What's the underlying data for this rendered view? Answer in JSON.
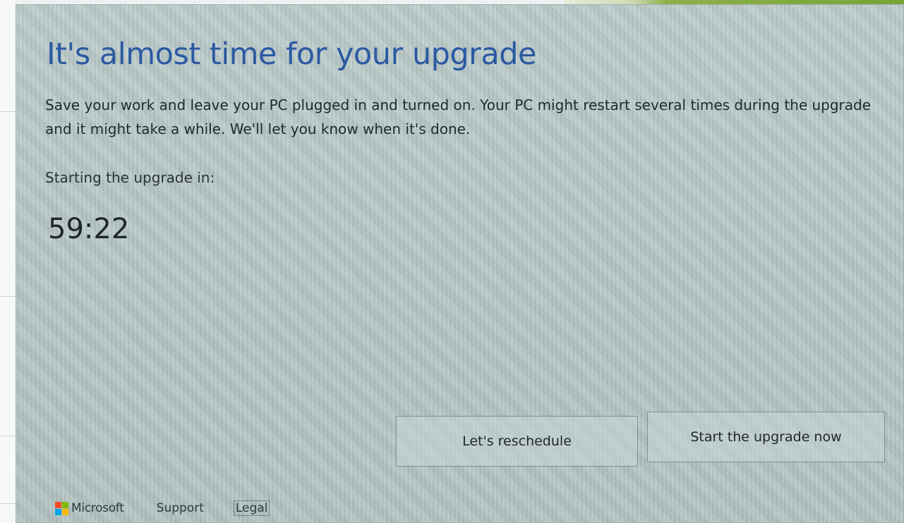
{
  "dialog": {
    "title": "It's almost time for your upgrade",
    "description": "Save your work and leave your PC plugged in and turned on. Your PC might restart several times during the upgrade and it might take a while. We'll let you know when it's done.",
    "countdown_label": "Starting the upgrade in:",
    "countdown_value": "59:22"
  },
  "buttons": {
    "reschedule_label": "Let's reschedule",
    "start_now_label": "Start the upgrade now"
  },
  "footer": {
    "brand": "Microsoft",
    "support": "Support",
    "legal": "Legal"
  },
  "colors": {
    "title": "#2b5aa3",
    "logo_red": "#f25022",
    "logo_green": "#7fba00",
    "logo_blue": "#00a4ef",
    "logo_yellow": "#ffb900"
  },
  "icons": {
    "brand_logo": "microsoft-logo-icon"
  }
}
